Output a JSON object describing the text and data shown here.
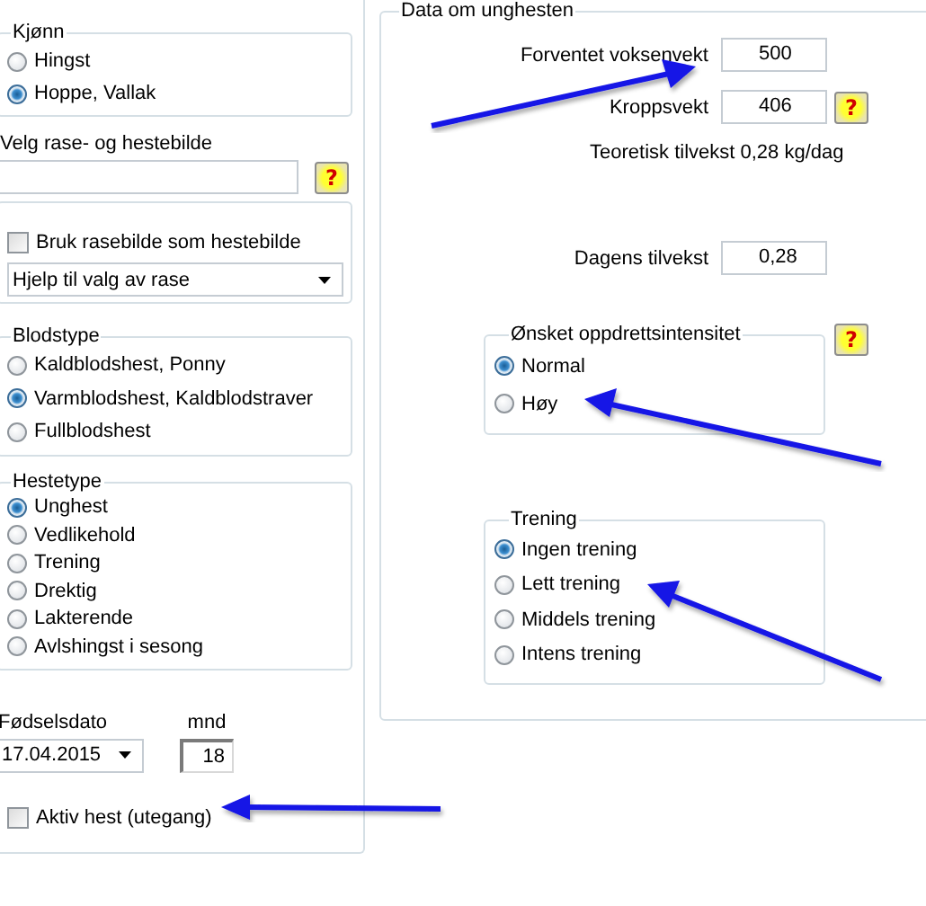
{
  "left": {
    "sex": {
      "legend": "Kjønn",
      "options": [
        {
          "label": "Hingst",
          "selected": false
        },
        {
          "label": "Hoppe, Vallak",
          "selected": true
        }
      ]
    },
    "breed": {
      "label": "Velg rase- og hestebilde",
      "help": "?"
    },
    "breed_picture": {
      "checkbox": {
        "label": "Bruk rasebilde som hestebilde",
        "checked": false
      },
      "dropdown": "Hjelp til valg av rase"
    },
    "blood_type": {
      "legend": "Blodstype",
      "options": [
        {
          "label": "Kaldblodshest, Ponny",
          "selected": false
        },
        {
          "label": "Varmblodshest, Kaldblodstraver",
          "selected": true
        },
        {
          "label": "Fullblodshest",
          "selected": false
        }
      ]
    },
    "horse_type": {
      "legend": "Hestetype",
      "options": [
        {
          "label": "Unghest",
          "selected": true
        },
        {
          "label": "Vedlikehold",
          "selected": false
        },
        {
          "label": "Trening",
          "selected": false
        },
        {
          "label": "Drektig",
          "selected": false
        },
        {
          "label": "Lakterende",
          "selected": false
        },
        {
          "label": "Avlshingst i sesong",
          "selected": false
        }
      ]
    },
    "birth_date": {
      "label": "Fødselsdato",
      "value": "17.04.2015"
    },
    "months": {
      "label": "mnd",
      "value": "18"
    },
    "active": {
      "label": "Aktiv hest (utegang)",
      "checked": false
    }
  },
  "right": {
    "legend": "Data om unghesten",
    "fields": [
      {
        "label": "Forventet voksenvekt",
        "value": "500"
      },
      {
        "label": "Kroppsvekt",
        "value": "406",
        "help": "?"
      }
    ],
    "note": "Teoretisk tilvekst 0,28 kg/dag",
    "daily": {
      "label": "Dagens tilvekst",
      "value": "0,28"
    },
    "intensity": {
      "legend": "Ønsket oppdrettsintensitet",
      "help": "?",
      "options": [
        {
          "label": "Normal",
          "selected": true
        },
        {
          "label": "Høy",
          "selected": false
        }
      ]
    },
    "training": {
      "legend": "Trening",
      "options": [
        {
          "label": "Ingen trening",
          "selected": true
        },
        {
          "label": "Lett trening",
          "selected": false
        },
        {
          "label": "Middels trening",
          "selected": false
        },
        {
          "label": "Intens trening",
          "selected": false
        }
      ]
    }
  }
}
